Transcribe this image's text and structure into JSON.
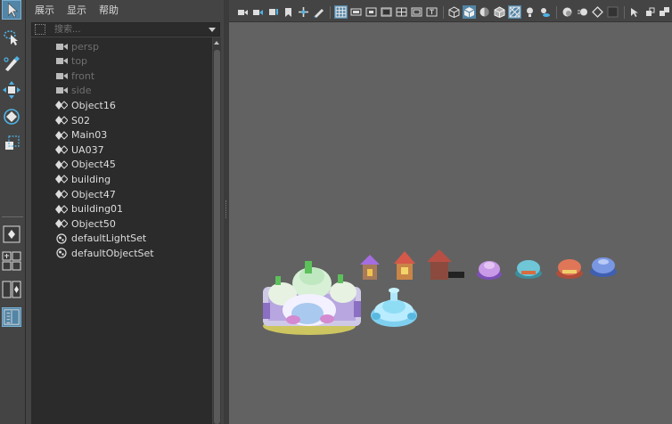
{
  "outliner": {
    "menu": [
      "展示",
      "显示",
      "帮助"
    ],
    "search_placeholder": "搜索...",
    "items": [
      {
        "label": "persp",
        "icon": "camera-icon",
        "dim": true
      },
      {
        "label": "top",
        "icon": "camera-icon",
        "dim": true
      },
      {
        "label": "front",
        "icon": "camera-icon",
        "dim": true
      },
      {
        "label": "side",
        "icon": "camera-icon",
        "dim": true
      },
      {
        "label": "Object16",
        "icon": "transform-icon",
        "dim": false
      },
      {
        "label": "S02",
        "icon": "transform-icon",
        "dim": false
      },
      {
        "label": "Main03",
        "icon": "transform-icon",
        "dim": false
      },
      {
        "label": "UA037",
        "icon": "transform-icon",
        "dim": false
      },
      {
        "label": "Object45",
        "icon": "transform-icon",
        "dim": false
      },
      {
        "label": "building",
        "icon": "transform-icon",
        "dim": false
      },
      {
        "label": "Object47",
        "icon": "transform-icon",
        "dim": false
      },
      {
        "label": "building01",
        "icon": "transform-icon",
        "dim": false
      },
      {
        "label": "Object50",
        "icon": "transform-icon",
        "dim": false
      },
      {
        "label": "defaultLightSet",
        "icon": "set-icon",
        "dim": false
      },
      {
        "label": "defaultObjectSet",
        "icon": "set-icon",
        "dim": false
      }
    ]
  },
  "toolbox": {
    "tools": [
      "select-tool-icon",
      "lasso-tool-icon",
      "paint-select-tool-icon",
      "move-tool-icon",
      "rotate-tool-icon",
      "scale-tool-icon"
    ],
    "layouts": [
      "single-pane-layout-icon",
      "four-pane-layout-icon",
      "two-pane-layout-icon",
      "outliner-layout-icon"
    ]
  },
  "viewport": {
    "toolbar_icons": [
      "camera-select-icon",
      "camera-attributes-icon",
      "bookmark-icon",
      "image-plane-icon",
      "transform-2d-icon",
      "grease-pencil-icon",
      "grid-icon",
      "film-gate-icon",
      "resolution-gate-icon",
      "gate-mask-icon",
      "field-chart-icon",
      "safe-action-icon",
      "safe-title-icon",
      "wireframe-icon",
      "smooth-shade-icon",
      "default-material-icon",
      "wireframe-on-shaded-icon",
      "xray-icon",
      "use-all-lights-icon",
      "shadows-icon",
      "screen-space-ao-icon",
      "motion-blur-icon",
      "multisample-aa-icon",
      "depth-of-field-icon",
      "isolate-select-icon",
      "xray-joints-icon",
      "xray-active-icon"
    ],
    "colors": {
      "background": "#626262",
      "accent": "#5285a6"
    }
  }
}
